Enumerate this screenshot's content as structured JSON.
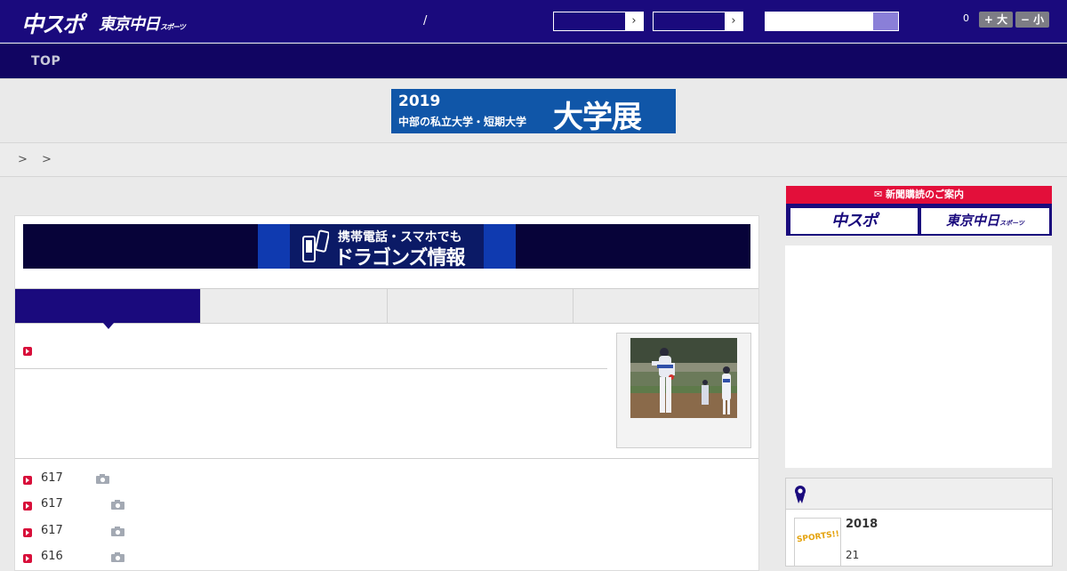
{
  "header": {
    "logo_chuspo": "中スポ",
    "logo_tokyo": "東京中日",
    "logo_tokyo_suffix": "スポーツ",
    "slash": "/",
    "select_arrow": "›",
    "font_size_value": "0",
    "font_plus_label": "+ 大",
    "font_minus_label": "− 小"
  },
  "nav": {
    "top_label": "TOP"
  },
  "promo": {
    "year": "2019",
    "subtitle": "中部の私立大学・短期大学",
    "big": "大学展"
  },
  "breadcrumb": {
    "text": "> >"
  },
  "dragons_banner": {
    "line1": "携帯電話・スマホでも",
    "line2": "ドラゴンズ情報"
  },
  "news_list": [
    {
      "num": "617"
    },
    {
      "num": "617"
    },
    {
      "num": "617"
    },
    {
      "num": "616"
    }
  ],
  "subscribe": {
    "header": "新聞購読のご案内",
    "btn_chuspo": "中スポ",
    "btn_tokyo": "東京中日",
    "btn_tokyo_suffix": "スポーツ"
  },
  "ranking": {
    "thumb_text": "SPORTS!!",
    "year": "2018",
    "number": "21"
  },
  "colors": {
    "brand_navy": "#1a0a7d",
    "nav_dark": "#110562",
    "accent_red": "#e30f3a",
    "promo_blue": "#1056a8"
  }
}
